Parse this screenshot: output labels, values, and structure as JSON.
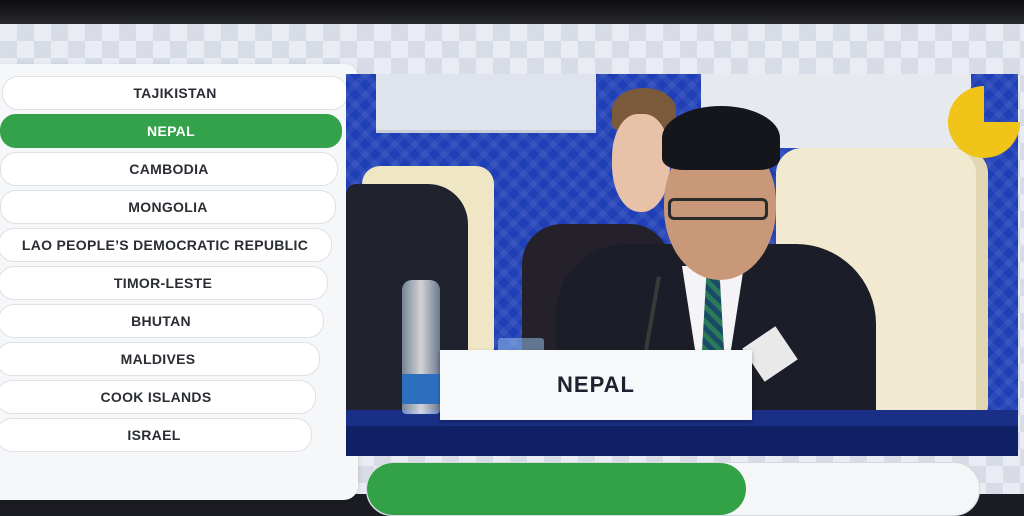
{
  "countries": [
    {
      "label": "TAJIKISTAN",
      "active": false
    },
    {
      "label": "NEPAL",
      "active": true
    },
    {
      "label": "CAMBODIA",
      "active": false
    },
    {
      "label": "MONGOLIA",
      "active": false
    },
    {
      "label": "LAO PEOPLE’S DEMOCRATIC REPUBLIC",
      "active": false
    },
    {
      "label": "TIMOR-LESTE",
      "active": false
    },
    {
      "label": "BHUTAN",
      "active": false
    },
    {
      "label": "MALDIVES",
      "active": false
    },
    {
      "label": "COOK ISLANDS",
      "active": false
    },
    {
      "label": "ISRAEL",
      "active": false
    }
  ],
  "video": {
    "nameplate": "NEPAL"
  },
  "speaking_time": {
    "progress_fraction": 0.62,
    "timer_elapsed_fraction": 0.75,
    "timer_icon": "pie-timer-icon"
  },
  "colors": {
    "active": "#34a24a",
    "progress": "#33a146",
    "timer": "#f0c419"
  }
}
